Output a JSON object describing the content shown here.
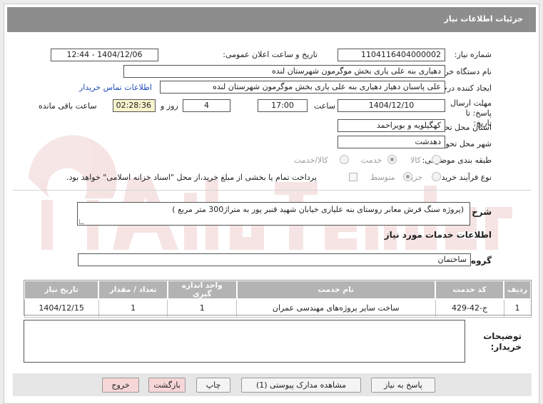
{
  "header": {
    "title": "جزئیات اطلاعات نیاز"
  },
  "fields": {
    "need_number_label": "شماره نیاز:",
    "need_number": "1104116404000002",
    "announce_label": "تاریخ و ساعت اعلان عمومی:",
    "announce_value": "1404/12/06 - 12:44",
    "buyer_org_label": "نام دستگاه خریدار:",
    "buyer_org": "دهیاری بنه علی یاری بخش موگرمون شهرستان لنده",
    "requester_label": "ایجاد کننده درخواست:",
    "requester": "علی پاسبان دهیار دهیاری بنه علی یاری بخش موگرمون شهرستان لنده",
    "contact_link": "اطلاعات تماس خریدار",
    "deadline_label": "مهلت ارسال پاسخ: تا تاریخ:",
    "deadline_date": "1404/12/10",
    "time_label": "ساعت",
    "deadline_time": "17:00",
    "days_value": "4",
    "days_label": "روز و",
    "remaining_time": "02:28:36",
    "remaining_label": "ساعت باقی مانده",
    "province_label": "استان محل تحویل:",
    "province": "کهگیلویه و بویراحمد",
    "city_label": "شهر محل تحویل:",
    "city": "دهدشت",
    "category_label": "طبقه بندی موضوعی:",
    "category_options": [
      "کالا",
      "خدمت",
      "کالا/خدمت"
    ],
    "process_label": "نوع فرآیند خرید :",
    "process_options": [
      "جزیی",
      "متوسط"
    ],
    "payment_note": "پرداخت تمام یا بخشی از مبلغ خرید،از محل \"اسناد خزانه اسلامی\" خواهد بود."
  },
  "description": {
    "label": "شرح کلی نیاز:",
    "text": "(پروژه سنگ فرش معابر روستای بنه علیاری خیابان شهید قنبر پور به متراژ300 متر مربع )"
  },
  "services": {
    "section_title": "اطلاعات خدمات مورد نیاز",
    "group_label": "گروه خدمت:",
    "group_value": "ساختمان",
    "table": {
      "headers": [
        "ردیف",
        "کد خدمت",
        "نام خدمت",
        "واحد اندازه گیری",
        "تعداد / مقدار",
        "تاریخ نیاز"
      ],
      "rows": [
        [
          "1",
          "ج-42-429",
          "ساخت سایر پروژه‌های مهندسی عمران",
          "1",
          "1",
          "1404/12/15"
        ]
      ]
    }
  },
  "buyer_notes": {
    "label": "توضیحات خریدار:",
    "text": ""
  },
  "buttons": {
    "reply": "پاسخ به نیاز",
    "attachments": "مشاهده مدارک پیوستی (1)",
    "print": "چاپ",
    "back": "بازگشت",
    "exit": "خروج"
  },
  "colors": {
    "header": "#8d8d8d",
    "table_header": "#b3b3b3",
    "link": "#1f4fb8",
    "remaining_bg": "#f7f3cc",
    "pink_button": "#f6d6d6"
  }
}
